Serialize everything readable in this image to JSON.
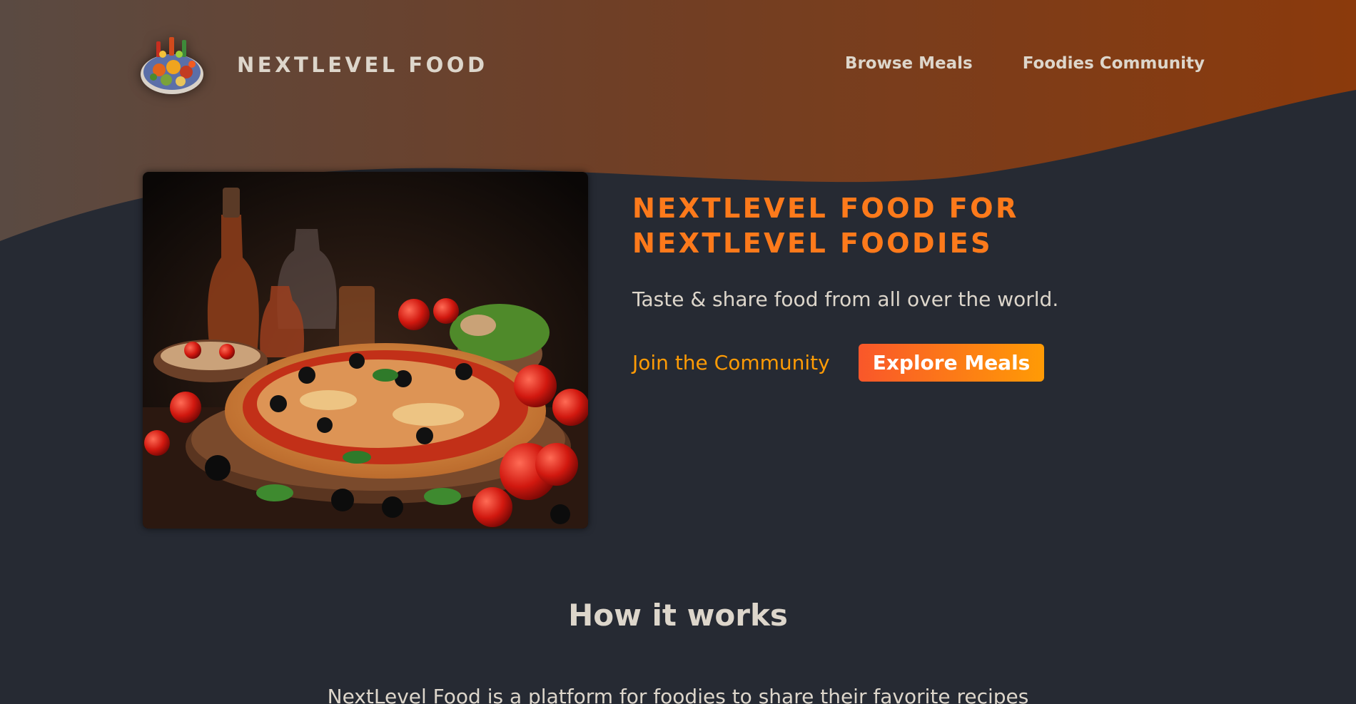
{
  "header": {
    "logo_alt": "A plate with food on it",
    "brand": "NextLevel Food",
    "nav": [
      {
        "label": "Browse Meals"
      },
      {
        "label": "Foodies Community"
      }
    ]
  },
  "hero": {
    "image_alt": "A delicious looking pizza",
    "title": "NextLevel Food for NextLevel Foodies",
    "subtitle": "Taste & share food from all over the world.",
    "join_label": "Join the Community",
    "explore_label": "Explore Meals"
  },
  "how_it_works": {
    "title": "How it works",
    "text": "NextLevel Food is a platform for foodies to share their favorite recipes"
  },
  "colors": {
    "background": "#282c34",
    "header_gradient_start": "#5a4b40",
    "header_gradient_end": "#8a3b0e",
    "accent_start": "#f9572a",
    "accent_end": "#ff9b05",
    "text": "#ddd6cb"
  }
}
